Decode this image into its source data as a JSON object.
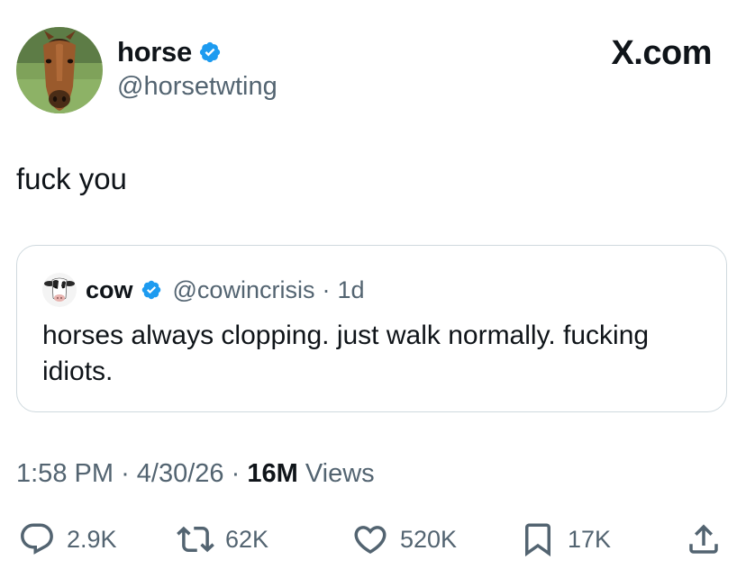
{
  "author": {
    "display_name": "horse",
    "handle": "@horsetwting"
  },
  "site_label": "X.com",
  "tweet": {
    "text": "fuck you"
  },
  "quote": {
    "display_name": "cow",
    "handle": "@cowincrisis",
    "separator": "·",
    "age": "1d",
    "text": "horses always clopping. just walk normally. fucking idiots."
  },
  "meta": {
    "time": "1:58 PM",
    "separator": "·",
    "date": "4/30/26",
    "views_count": "16M",
    "views_label": "Views"
  },
  "actions": {
    "replies": "2.9K",
    "reposts": "62K",
    "likes": "520K",
    "bookmarks": "17K"
  },
  "colors": {
    "verified": "#1d9bf0",
    "secondary_text": "#536471",
    "primary_text": "#0f1419",
    "border": "#cfd9de"
  },
  "icons": {
    "verified": "verified-badge-icon",
    "reply": "reply-icon",
    "repost": "repost-icon",
    "like": "heart-icon",
    "bookmark": "bookmark-icon",
    "share": "share-icon"
  }
}
